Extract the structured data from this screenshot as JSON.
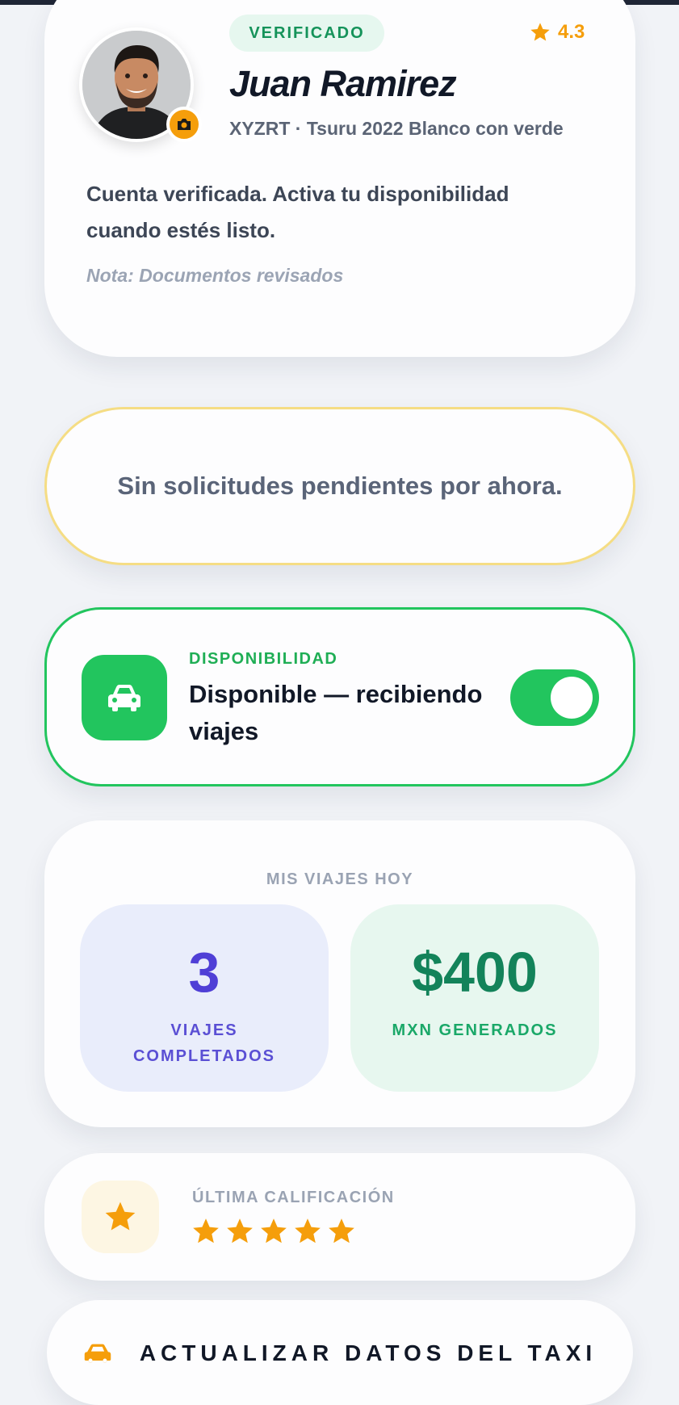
{
  "profile": {
    "badge": "VERIFICADO",
    "rating": "4.3",
    "name": "Juan Ramirez",
    "vehicle": "XYZRT · Tsuru 2022 Blanco con verde",
    "description": "Cuenta verificada. Activa tu disponibilidad cuando estés listo.",
    "note": "Nota: Documentos revisados",
    "avatar_icon": "driver-avatar",
    "camera_icon": "camera-icon"
  },
  "pending": {
    "message": "Sin solicitudes pendientes por ahora."
  },
  "availability": {
    "label": "DISPONIBILIDAD",
    "status": "Disponible — recibiendo viajes",
    "toggle_on": true,
    "icon": "car-icon"
  },
  "stats": {
    "title": "MIS VIAJES HOY",
    "trips_value": "3",
    "trips_label": "VIAJES COMPLETADOS",
    "money_value": "$400",
    "money_label": "MXN GENERADOS"
  },
  "last_rating": {
    "label": "ÚLTIMA CALIFICACIÓN",
    "stars": 5,
    "max_stars": 5
  },
  "update_button": {
    "label": "ACTUALIZAR DATOS DEL TAXI",
    "icon": "taxi-icon"
  },
  "colors": {
    "accent_green": "#22c55e",
    "star_amber": "#f59e0b",
    "trips_purple": "#4f3fd6",
    "money_green": "#13835a",
    "pending_border": "#f5dd84"
  }
}
